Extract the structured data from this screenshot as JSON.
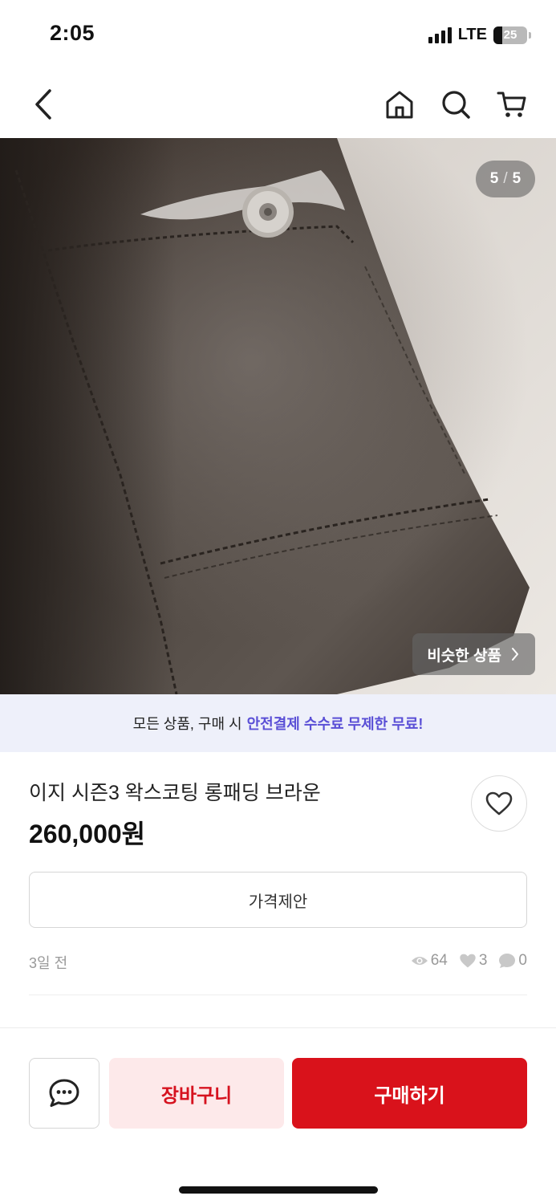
{
  "status_bar": {
    "time": "2:05",
    "network": "LTE",
    "battery": "25",
    "battery_level": 0.25
  },
  "nav": {
    "back_icon": "chevron-left-icon",
    "home_icon": "home-icon",
    "search_icon": "search-icon",
    "cart_icon": "cart-icon"
  },
  "image": {
    "current": "5",
    "separator": "/",
    "total": "5",
    "similar_label": "비슷한 상품",
    "similar_icon": "chevron-right-icon"
  },
  "promo": {
    "text": "모든 상품, 구매 시",
    "highlight": "안전결제 수수료 무제한 무료!",
    "highlight_color": "#5a4fd6",
    "background": "#eef0fa"
  },
  "product": {
    "title": "이지 시즌3 왁스코팅 롱패딩 브라운",
    "price": "260,000원",
    "offer_label": "가격제안",
    "posted": "3일 전",
    "views": "64",
    "likes": "3",
    "chats": "0"
  },
  "actions": {
    "chat_icon": "chat-bubble-icon",
    "cart_label": "장바구니",
    "buy_label": "구매하기",
    "accent": "#d9121b"
  }
}
